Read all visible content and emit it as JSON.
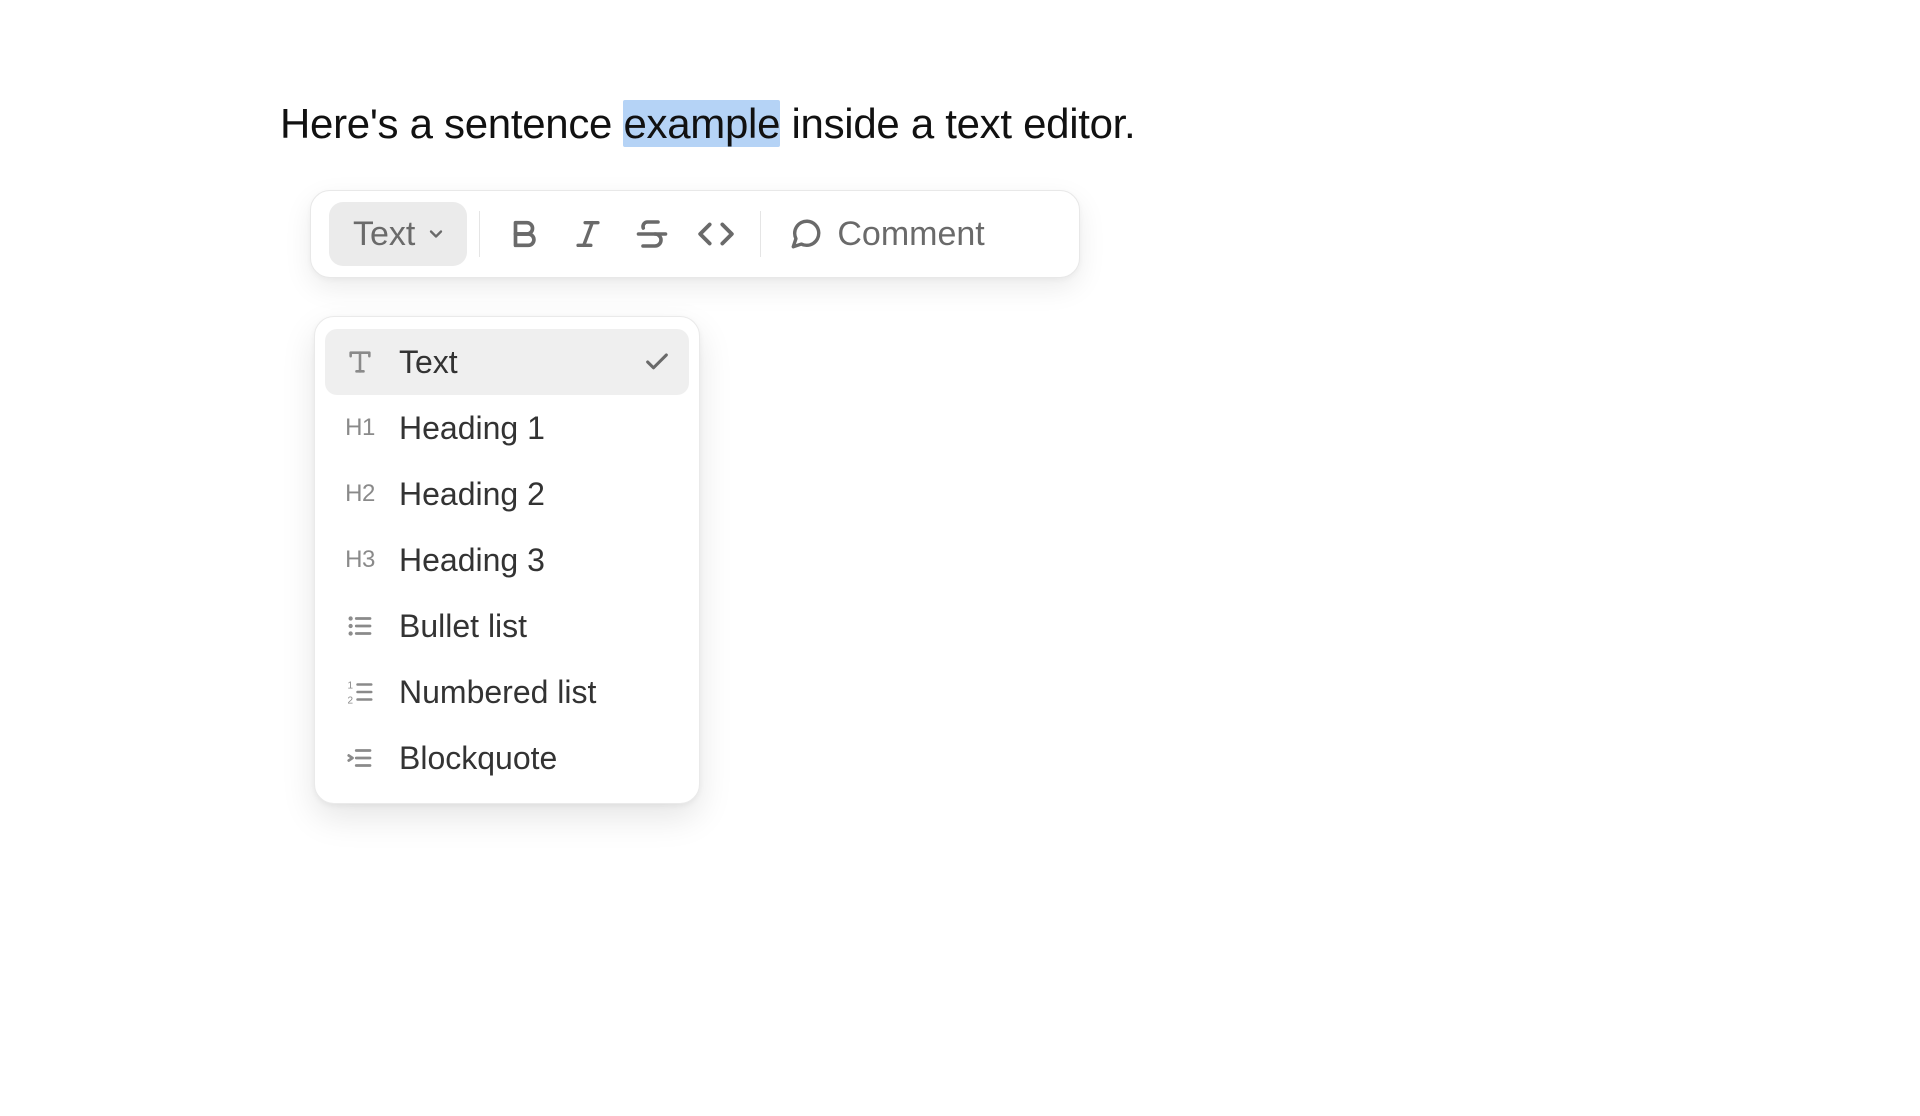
{
  "editor": {
    "text_before": "Here's a sentence ",
    "text_highlighted": "example",
    "text_after": " inside a text editor."
  },
  "toolbar": {
    "block_type_label": "Text",
    "comment_label": "Comment"
  },
  "dropdown": {
    "items": [
      {
        "icon": "T",
        "label": "Text",
        "selected": true
      },
      {
        "icon": "H1",
        "label": "Heading 1",
        "selected": false
      },
      {
        "icon": "H2",
        "label": "Heading 2",
        "selected": false
      },
      {
        "icon": "H3",
        "label": "Heading 3",
        "selected": false
      },
      {
        "icon": "bullet",
        "label": "Bullet list",
        "selected": false
      },
      {
        "icon": "number",
        "label": "Numbered list",
        "selected": false
      },
      {
        "icon": "quote",
        "label": "Blockquote",
        "selected": false
      }
    ]
  }
}
